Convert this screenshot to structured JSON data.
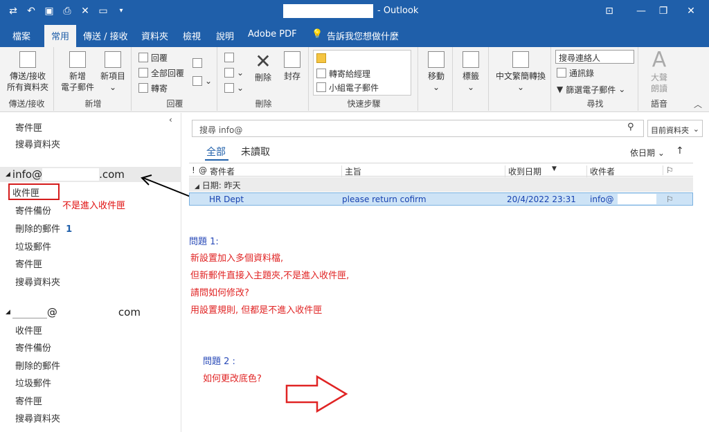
{
  "window": {
    "app_title": "- Outlook"
  },
  "qat": {
    "icons": [
      "send-receive-icon",
      "undo-icon",
      "save-icon",
      "print-icon",
      "close-icon",
      "window-icon",
      "customize-icon"
    ]
  },
  "menu": {
    "tabs": [
      "檔案",
      "常用",
      "傳送 / 接收",
      "資料夾",
      "檢視",
      "說明",
      "Adobe PDF"
    ],
    "tell_me": "告訴我您想做什麼"
  },
  "ribbon": {
    "send_receive": {
      "btn": "傳送/接收",
      "btn2": "所有資料夾",
      "label": "傳送/接收"
    },
    "new": {
      "new_mail": "新增",
      "new_mail2": "電子郵件",
      "new_items": "新項目",
      "label": "新增"
    },
    "respond": {
      "reply": "回覆",
      "reply_all": "全部回覆",
      "forward": "轉寄",
      "label": "回覆"
    },
    "delete": {
      "delete": "刪除",
      "archive": "封存",
      "label": "刪除"
    },
    "quick_steps": {
      "item1": "轉寄給經理",
      "item2": "小組電子郵件",
      "label": "快速步驟"
    },
    "move": {
      "move": "移動",
      "label": ""
    },
    "tags": {
      "tags": "標籤"
    },
    "chinese": {
      "convert": "中文繁簡轉換"
    },
    "find": {
      "search_people": "搜尋連絡人",
      "address_book": "通訊錄",
      "filter_email": "篩選電子郵件",
      "label": "尋找"
    },
    "speech": {
      "read": "大聲",
      "read2": "朗讀",
      "label": "語音"
    }
  },
  "sidebar": {
    "top": [
      "寄件匣",
      "搜尋資料夾"
    ],
    "account1": {
      "prefix": "info@",
      "suffix": ".com",
      "folders": [
        "收件匣",
        "寄件備份",
        "刪除的郵件",
        "垃圾郵件",
        "寄件匣",
        "搜尋資料夾"
      ],
      "deleted_count": "1"
    },
    "annotation": "不是進入收件匣",
    "account2": {
      "prefix": "@",
      "suffix": "com",
      "folders": [
        "收件匣",
        "寄件備份",
        "刪除的郵件",
        "垃圾郵件",
        "寄件匣",
        "搜尋資料夾"
      ]
    }
  },
  "search": {
    "placeholder": "搜尋 info@",
    "scope": "目前資料夾"
  },
  "filters": {
    "all": "全部",
    "unread": "未讀取",
    "sort": "依日期"
  },
  "columns": {
    "flags": "!",
    "from": "寄件者",
    "subject": "主旨",
    "received": "收到日期",
    "to": "收件者"
  },
  "group": "日期: 昨天",
  "message": {
    "from": "HR Dept",
    "subject": "please return cofirm",
    "received": "20/4/2022 23:31",
    "to": "info@"
  },
  "question1": {
    "title": "問題  1:",
    "lines": [
      "新設置加入多個資料檔,",
      "但新郵件直接入主題夾,不是進入收件匣,",
      "請問如何修改?",
      "用設置規則, 但都是不進入收件匣"
    ]
  },
  "question2": {
    "title": "問題  2 :",
    "line": "如何更改底色?"
  },
  "colors": {
    "title_blue": "#1f5faa",
    "annotation_red": "#e02424",
    "question_blue": "#2a4bb8"
  }
}
